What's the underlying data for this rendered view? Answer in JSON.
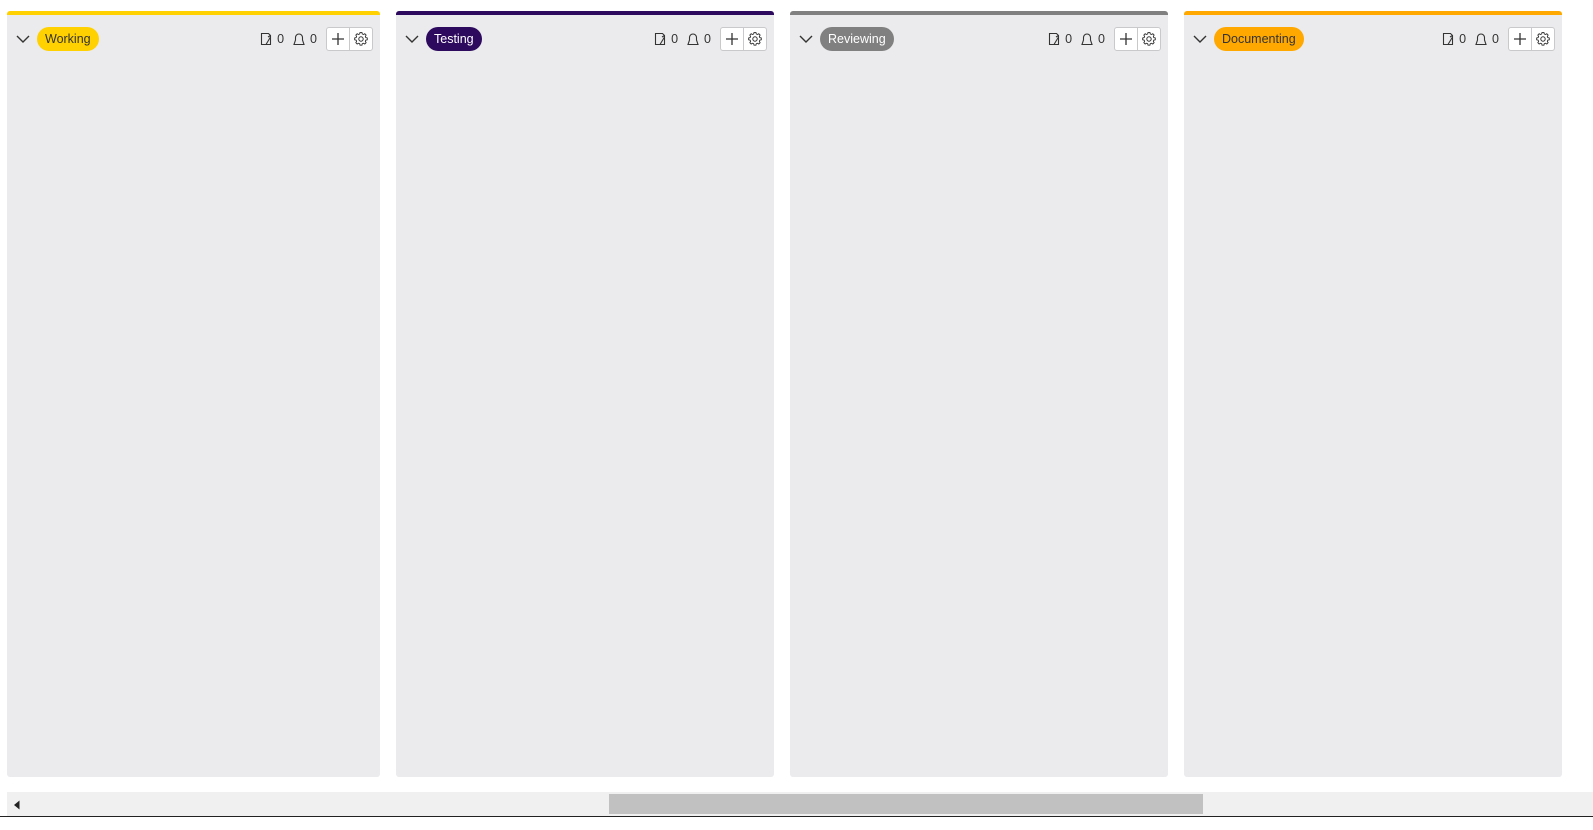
{
  "columns": [
    {
      "label": "Working",
      "accent_color": "#ffd100",
      "pill_bg": "#ffd100",
      "pill_text_color": "#333333",
      "card_count": "0",
      "assignee_count": "0"
    },
    {
      "label": "Testing",
      "accent_color": "#2d0a5e",
      "pill_bg": "#2d0a5e",
      "pill_text_color": "#ffffff",
      "card_count": "0",
      "assignee_count": "0"
    },
    {
      "label": "Reviewing",
      "accent_color": "#808080",
      "pill_bg": "#808080",
      "pill_text_color": "#ffffff",
      "card_count": "0",
      "assignee_count": "0"
    },
    {
      "label": "Documenting",
      "accent_color": "#ffa800",
      "pill_bg": "#ffa800",
      "pill_text_color": "#333333",
      "card_count": "0",
      "assignee_count": "0"
    }
  ],
  "icons": {
    "collapse": "chevron-down-icon",
    "cards": "card-icon",
    "assignees": "user-icon",
    "add": "plus-icon",
    "settings": "gear-icon",
    "scroll_left": "triangle-left-icon"
  }
}
